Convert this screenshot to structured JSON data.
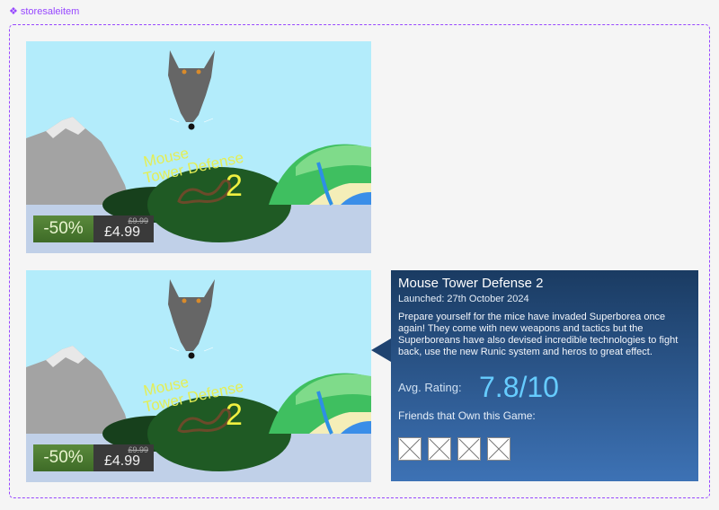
{
  "component": {
    "label": "storesaleitem",
    "icon": "component-diamond-icon"
  },
  "game_art": {
    "title_line1": "Mouse",
    "title_line2": "Tower Defense",
    "title_number": "2"
  },
  "cards": [
    {
      "discount": "-50%",
      "original_price": "£9.99",
      "final_price": "£4.99"
    },
    {
      "discount": "-50%",
      "original_price": "£9.99",
      "final_price": "£4.99"
    }
  ],
  "tooltip": {
    "title": "Mouse Tower Defense 2",
    "launched": "Launched: 27th October 2024",
    "description": "Prepare yourself for the mice have invaded Superborea once again! They come with new weapons and tactics but the Superboreans have also devised incredible technologies to fight back, use the new Runic system and heros to great effect.",
    "rating_label": "Avg. Rating:",
    "rating_value": "7.8/10",
    "friends_label": "Friends that Own this Game:",
    "friends_count": 4
  },
  "colors": {
    "sky": "#b3ecfb",
    "water": "#c0d0e8",
    "discount_green": "#4b7b30",
    "price_bg": "#3a3a3a",
    "tooltip_top": "#1a3b62",
    "tooltip_bottom": "#3d72b5",
    "rating_blue": "#66ccff",
    "figma_purple": "#9747ff"
  }
}
